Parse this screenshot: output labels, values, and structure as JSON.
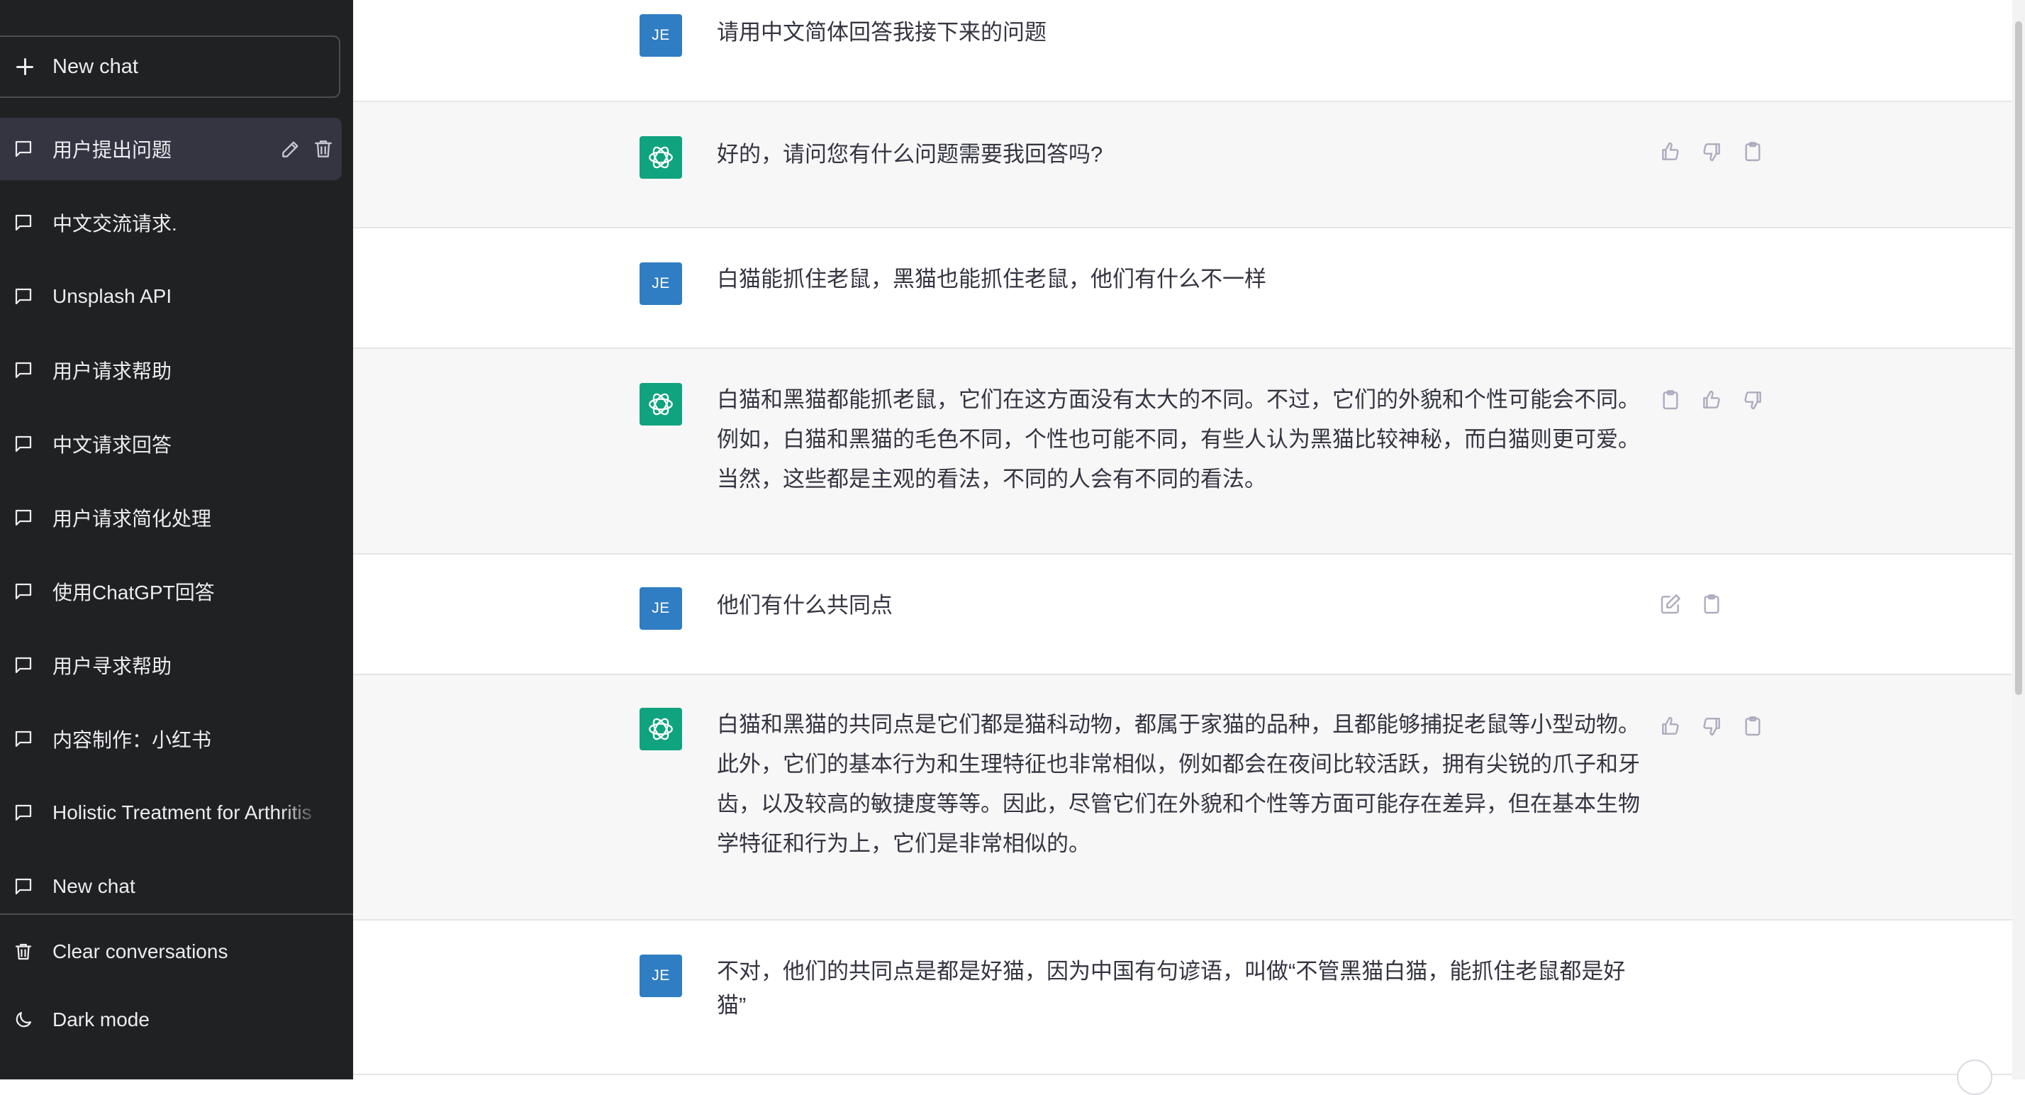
{
  "sidebar": {
    "new_chat_label": "New chat",
    "conversations": [
      {
        "label": "用户提出问题",
        "active": true
      },
      {
        "label": "中文交流请求."
      },
      {
        "label": "Unsplash API"
      },
      {
        "label": "用户请求帮助"
      },
      {
        "label": "中文请求回答"
      },
      {
        "label": "用户请求简化处理"
      },
      {
        "label": "使用ChatGPT回答"
      },
      {
        "label": "用户寻求帮助"
      },
      {
        "label": "内容制作：小红书"
      },
      {
        "label": "Holistic Treatment for Arthritis"
      },
      {
        "label": "New chat"
      }
    ],
    "clear_label": "Clear conversations",
    "dark_mode_label": "Dark mode"
  },
  "user_avatar_text": "JE",
  "messages": [
    {
      "role": "user",
      "text": "请用中文简体回答我接下来的问题"
    },
    {
      "role": "assistant",
      "text": "好的，请问您有什么问题需要我回答吗?"
    },
    {
      "role": "user",
      "text": "白猫能抓住老鼠，黑猫也能抓住老鼠，他们有什么不一样"
    },
    {
      "role": "assistant",
      "text": "白猫和黑猫都能抓老鼠，它们在这方面没有太大的不同。不过，它们的外貌和个性可能会不同。例如，白猫和黑猫的毛色不同，个性也可能不同，有些人认为黑猫比较神秘，而白猫则更可爱。当然，这些都是主观的看法，不同的人会有不同的看法。"
    },
    {
      "role": "user",
      "text": "他们有什么共同点"
    },
    {
      "role": "assistant",
      "text": "白猫和黑猫的共同点是它们都是猫科动物，都属于家猫的品种，且都能够捕捉老鼠等小型动物。此外，它们的基本行为和生理特征也非常相似，例如都会在夜间比较活跃，拥有尖锐的爪子和牙齿，以及较高的敏捷度等等。因此，尽管它们在外貌和个性等方面可能存在差异，但在基本生物学特征和行为上，它们是非常相似的。"
    },
    {
      "role": "user",
      "text": "不对，他们的共同点是都是好猫，因为中国有句谚语，叫做“不管黑猫白猫，能抓住老鼠都是好猫”"
    }
  ],
  "colors": {
    "sidebar_bg": "#202123",
    "assistant_row_bg": "#f7f7f8",
    "user_avatar": "#2f7dc2",
    "bot_avatar": "#10a37f"
  },
  "icons": {
    "new_chat": "plus-icon",
    "conversation": "chat-bubble-icon",
    "edit": "pencil-icon",
    "delete": "trash-icon",
    "clear": "trash-icon",
    "dark_mode": "moon-icon",
    "thumbs_up": "thumbs-up-icon",
    "thumbs_down": "thumbs-down-icon",
    "copy": "clipboard-icon",
    "edit_message": "edit-icon",
    "scroll_down": "arrow-down-icon"
  }
}
